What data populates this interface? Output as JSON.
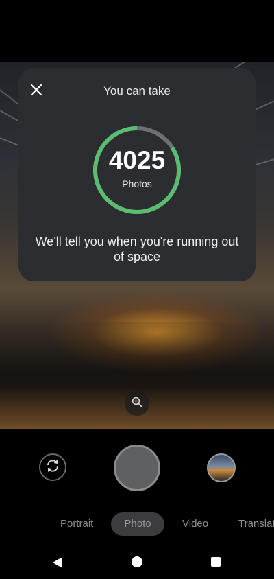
{
  "storage_dialog": {
    "title": "You can take",
    "count": "4025",
    "unit": "Photos",
    "message": "We'll tell you when you're running out of space",
    "close_icon": "close-icon",
    "ring": {
      "fraction_used": 0.84,
      "used_color": "#5bbd72",
      "remaining_color": "#6e7073"
    }
  },
  "viewfinder": {
    "zoom_icon": "zoom-in-icon"
  },
  "controls": {
    "switch_camera_icon": "switch-camera-icon",
    "shutter": "shutter-button",
    "last_photo": "thumbnail"
  },
  "modes": [
    {
      "label": "Portrait",
      "active": false
    },
    {
      "label": "Photo",
      "active": true
    },
    {
      "label": "Video",
      "active": false
    },
    {
      "label": "Translat",
      "active": false
    }
  ],
  "navbar": {
    "back_icon": "back-icon",
    "home_icon": "home-icon",
    "recents_icon": "recents-icon"
  }
}
